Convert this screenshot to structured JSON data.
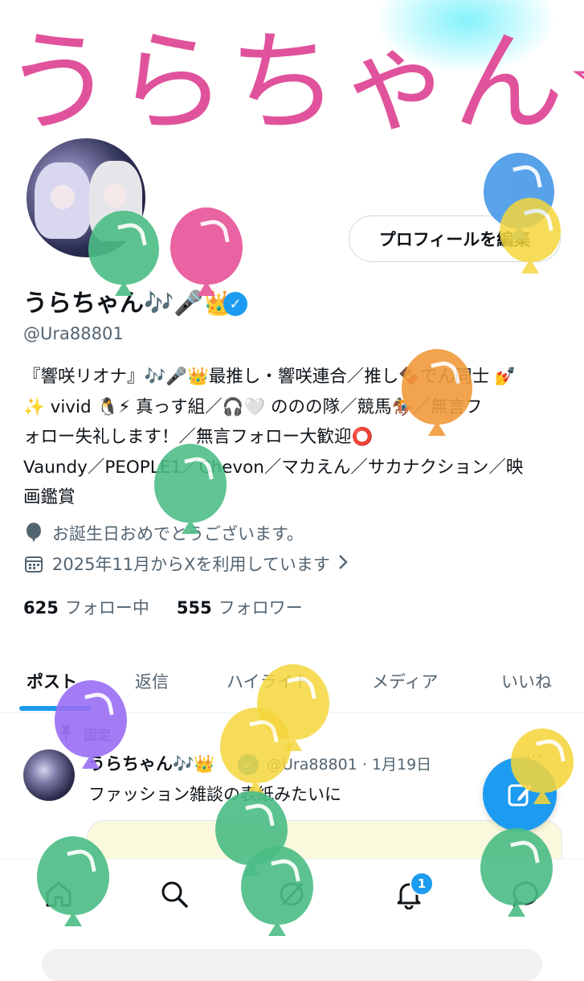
{
  "banner": {
    "text": "うらちゃん☆"
  },
  "profile": {
    "edit_label": "プロフィールを編集",
    "display_name": "うらちゃん🎶🎤👑",
    "verified_glyph": "✓",
    "handle": "@Ura88801",
    "bio_lines": [
      "『響咲リオナ』🎶🎤👑最推し・響咲連合／推し🍫でん同士 💅",
      "✨ vivid 🐧⚡ 真っす組／🎧🤍 ののの隊／競馬🏇／無言フ",
      "ォロー失礼します！／無言フォロー大歓迎⭕",
      "Vaundy／PEOPLE1／Chevon／マカえん／サカナクション／映",
      "画鑑賞"
    ],
    "birthday_text": "お誕生日おめでとうございます。",
    "joined_text": "2025年11月からXを利用しています",
    "following_count": "625",
    "following_label": "フォロー中",
    "followers_count": "555",
    "followers_label": "フォロワー"
  },
  "tabs": [
    "ポスト",
    "返信",
    "ハイライト",
    "メディア",
    "いいね"
  ],
  "active_tab": "ポスト",
  "pinned_post": {
    "pinned_label": "固定",
    "author": "うらちゃん🎶👑",
    "meta": "@Ura88801 · 1月19日",
    "text": "ファッション雑談の表紙みたいに",
    "more": "···"
  },
  "bottom_nav": {
    "items": [
      "home-icon",
      "search-icon",
      "grok-icon",
      "notifications-icon",
      "messages-icon"
    ],
    "notification_badge": "1"
  },
  "colors": {
    "accent": "#1d9bf0",
    "banner_text": "#e0539c",
    "text_primary": "#0f1419",
    "text_secondary": "#536471",
    "balloon_blue": "#4a9be8",
    "balloon_yellow": "#f5d63c",
    "balloon_green": "#4bbd85",
    "balloon_pink": "#e85a9c",
    "balloon_orange": "#f09a3a",
    "balloon_purple": "#9a6ef5"
  }
}
